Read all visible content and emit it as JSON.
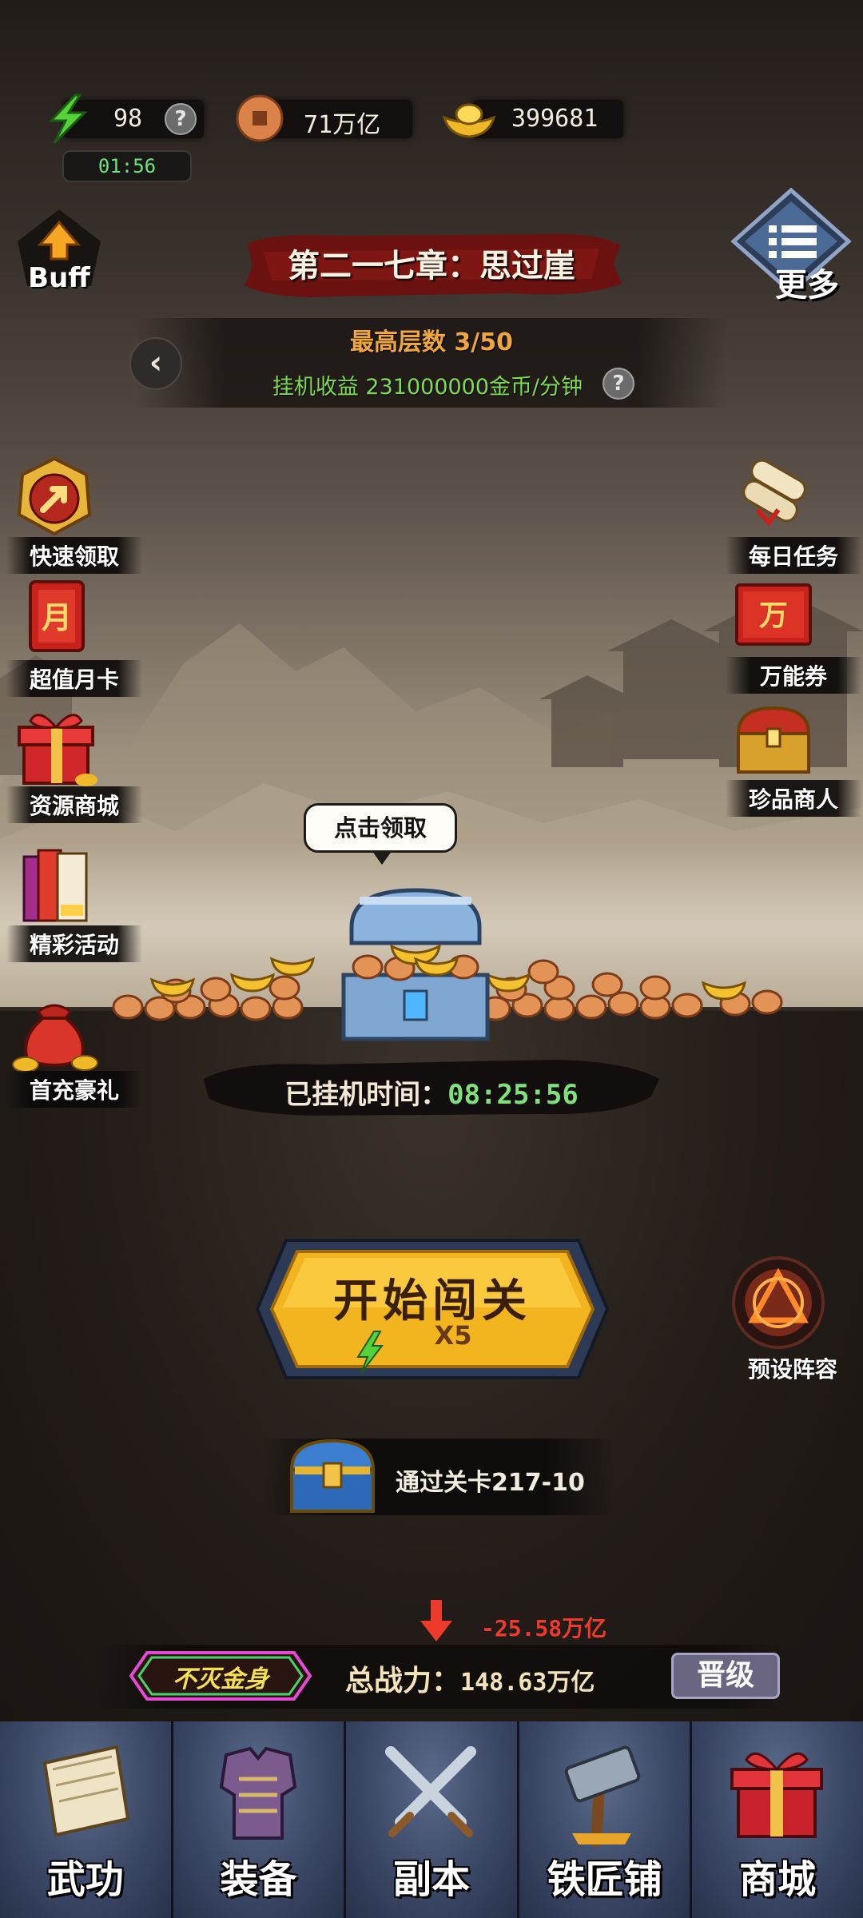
{
  "resources": {
    "energy": {
      "icon": "lightning-icon",
      "value": "98"
    },
    "copper": {
      "icon": "copper-coin-icon",
      "value": "71万亿"
    },
    "gold": {
      "icon": "gold-ingot-icon",
      "value": "399681"
    },
    "help_symbol": "?",
    "timer": "01:56"
  },
  "buff": {
    "label": "Buff",
    "icon": "arrow-up-icon"
  },
  "more": {
    "label": "更多",
    "icon": "menu-list-icon"
  },
  "chapter": {
    "title": "第二一七章：思过崖",
    "max_floor": "最高层数 3/50",
    "idle_income": "挂机收益 231000000金币/分钟",
    "back_symbol": "‹"
  },
  "left_menu": [
    {
      "label": "快速领取",
      "icon": "quick-claim-icon"
    },
    {
      "label": "超值月卡",
      "icon": "month-card-icon",
      "glyph": "月"
    },
    {
      "label": "资源商城",
      "icon": "gift-box-icon"
    },
    {
      "label": "精彩活动",
      "icon": "activity-books-icon"
    },
    {
      "label": "首充豪礼",
      "icon": "money-bag-icon"
    }
  ],
  "right_menu": [
    {
      "label": "每日任务",
      "icon": "scroll-icon"
    },
    {
      "label": "万能券",
      "icon": "voucher-icon",
      "glyph": "万"
    },
    {
      "label": "珍品商人",
      "icon": "treasure-chest-icon"
    }
  ],
  "chest": {
    "tooltip": "点击领取",
    "idle_time_label": "已挂机时间：",
    "idle_time_value": "08:25:56"
  },
  "start": {
    "label": "开始闯关",
    "cost": "X5"
  },
  "preset": {
    "label": "预设阵容",
    "icon": "formation-icon"
  },
  "reward": {
    "text": "通过关卡217-10",
    "icon": "blue-chest-icon"
  },
  "power": {
    "badge": "不灭金身",
    "label": "总战力：",
    "value": "148.63万亿",
    "delta": "-25.58万亿",
    "upgrade": "晋级"
  },
  "nav": [
    {
      "label": "武功",
      "icon": "martial-scroll-icon"
    },
    {
      "label": "装备",
      "icon": "armor-icon"
    },
    {
      "label": "副本",
      "icon": "crossed-swords-icon"
    },
    {
      "label": "铁匠铺",
      "icon": "hammer-icon"
    },
    {
      "label": "商城",
      "icon": "gift-box-icon"
    }
  ],
  "colors": {
    "accent_orange": "#f0a640",
    "income_green": "#7fdc4f",
    "timer_green": "#6fe27c",
    "delta_red": "#ee3a2a",
    "nav_bg": "#3b4866"
  }
}
